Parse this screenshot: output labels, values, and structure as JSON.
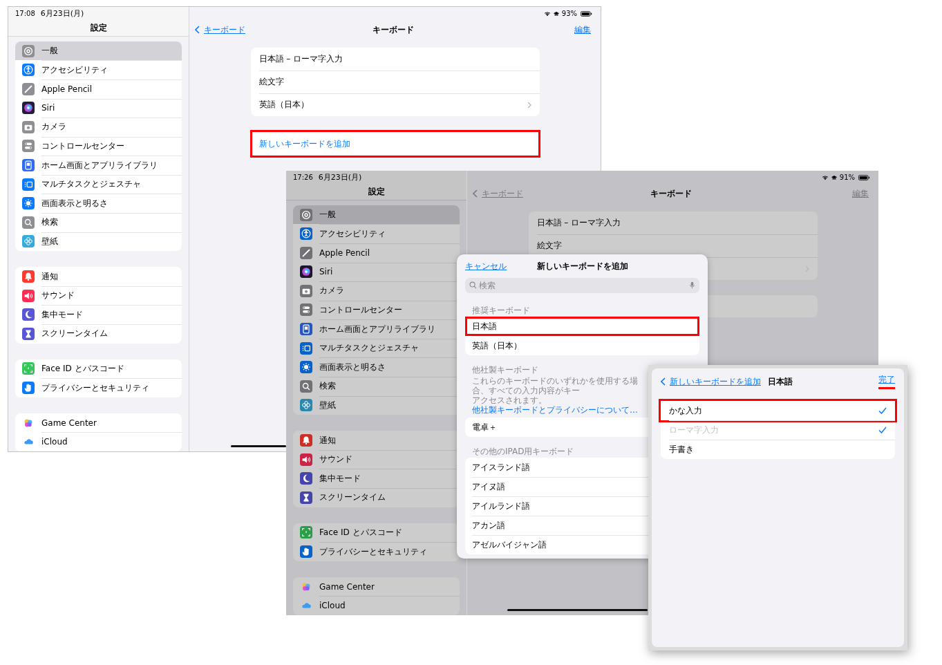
{
  "screenshots": [
    {
      "status_bar": {
        "time": "17:08",
        "date": "6月23日(月)",
        "battery": "93%"
      },
      "sidebar": {
        "title": "設定",
        "groups": [
          [
            {
              "label": "一般",
              "color": "#8e8e93",
              "selected": true
            },
            {
              "label": "アクセシビリティ",
              "color": "#0a7aff",
              "selected": false
            },
            {
              "label": "Apple Pencil",
              "color": "#8e8e93",
              "selected": false
            },
            {
              "label": "Siri",
              "color": "#1f1d3a",
              "selected": false
            },
            {
              "label": "カメラ",
              "color": "#8e8e93",
              "selected": false
            },
            {
              "label": "コントロールセンター",
              "color": "#8e8e93",
              "selected": false
            },
            {
              "label": "ホーム画面とアプリライブラリ",
              "color": "#2f6cf0",
              "selected": false
            },
            {
              "label": "マルチタスクとジェスチャ",
              "color": "#0a7aff",
              "selected": false
            },
            {
              "label": "画面表示と明るさ",
              "color": "#0a7aff",
              "selected": false
            },
            {
              "label": "検索",
              "color": "#8e8e93",
              "selected": false
            },
            {
              "label": "壁紙",
              "color": "#35aadc",
              "selected": false
            }
          ],
          [
            {
              "label": "通知",
              "color": "#ff3b30",
              "selected": false
            },
            {
              "label": "サウンド",
              "color": "#ff2d55",
              "selected": false
            },
            {
              "label": "集中モード",
              "color": "#5856d6",
              "selected": false
            },
            {
              "label": "スクリーンタイム",
              "color": "#5856d6",
              "selected": false
            }
          ],
          [
            {
              "label": "Face ID とパスコード",
              "color": "#34c759",
              "selected": false
            },
            {
              "label": "プライバシーとセキュリティ",
              "color": "#0a7aff",
              "selected": false
            }
          ],
          [
            {
              "label": "Game Center",
              "color": "#ffffff",
              "selected": false
            },
            {
              "label": "iCloud",
              "color": "#ffffff",
              "selected": false
            }
          ]
        ]
      },
      "detail": {
        "back": "キーボード",
        "title": "キーボード",
        "edit": "編集",
        "rows": [
          {
            "label": "日本語 – ローマ字入力",
            "chevron": false
          },
          {
            "label": "絵文字",
            "chevron": false
          },
          {
            "label": "英語（日本）",
            "chevron": true
          }
        ],
        "add_button": {
          "label": "新しいキーボードを追加",
          "highlighted": true
        }
      }
    },
    {
      "status_bar": {
        "time": "17:26",
        "date": "6月23日(月)",
        "battery": "91%"
      },
      "sidebar": {
        "title": "設定",
        "groups": [
          [
            {
              "label": "一般",
              "color": "#727276",
              "selected": true
            },
            {
              "label": "アクセシビリティ",
              "color": "#0862cc",
              "selected": false
            },
            {
              "label": "Apple Pencil",
              "color": "#727276",
              "selected": false
            },
            {
              "label": "Siri",
              "color": "#19172e",
              "selected": false
            },
            {
              "label": "カメラ",
              "color": "#727276",
              "selected": false
            },
            {
              "label": "コントロールセンター",
              "color": "#727276",
              "selected": false
            },
            {
              "label": "ホーム画面とアプリライブラリ",
              "color": "#2656c0",
              "selected": false
            },
            {
              "label": "マルチタスクとジェスチャ",
              "color": "#0862cc",
              "selected": false
            },
            {
              "label": "画面表示と明るさ",
              "color": "#0862cc",
              "selected": false
            },
            {
              "label": "検索",
              "color": "#727276",
              "selected": false
            },
            {
              "label": "壁紙",
              "color": "#2a88b0",
              "selected": false
            }
          ],
          [
            {
              "label": "通知",
              "color": "#cc2f26",
              "selected": false
            },
            {
              "label": "サウンド",
              "color": "#cc2444",
              "selected": false
            },
            {
              "label": "集中モード",
              "color": "#4645ab",
              "selected": false
            },
            {
              "label": "スクリーンタイム",
              "color": "#4645ab",
              "selected": false
            }
          ],
          [
            {
              "label": "Face ID とパスコード",
              "color": "#2a9f47",
              "selected": false
            },
            {
              "label": "プライバシーとセキュリティ",
              "color": "#0862cc",
              "selected": false
            }
          ],
          [
            {
              "label": "Game Center",
              "color": "#cccccc",
              "selected": false
            },
            {
              "label": "iCloud",
              "color": "#cccccc",
              "selected": false
            }
          ]
        ]
      },
      "detail": {
        "back": "キーボード",
        "title": "キーボード",
        "edit": "編集",
        "rows": [
          {
            "label": "日本語 – ローマ字入力",
            "chevron": false
          },
          {
            "label": "絵文字",
            "chevron": false
          },
          {
            "chevron": true
          }
        ]
      },
      "modal": {
        "cancel": "キャンセル",
        "title": "新しいキーボードを追加",
        "search_placeholder": "検索",
        "sections": [
          {
            "header": "推奨キーボード",
            "rows": [
              {
                "label": "日本語",
                "highlighted": true
              },
              {
                "label": "英語（日本）",
                "highlighted": false
              }
            ]
          },
          {
            "header": "他社製キーボード",
            "note": "これらのキーボードのいずれかを使用する場合、すべての入力内容がキー",
            "note_2": "アクセスされます。",
            "note_link": "他社製キーボードとプライバシーについて…",
            "rows": [
              {
                "label": "電卓＋",
                "highlighted": false
              }
            ]
          },
          {
            "header": "その他のIPAD用キーボード",
            "rows": [
              {
                "label": "アイスランド語",
                "highlighted": false
              },
              {
                "label": "アイヌ語",
                "highlighted": false
              },
              {
                "label": "アイルランド語",
                "highlighted": false
              },
              {
                "label": "アカン語",
                "highlighted": false
              },
              {
                "label": "アゼルバイジャン語",
                "highlighted": false
              }
            ]
          }
        ]
      }
    }
  ],
  "japanese_sheet": {
    "back": "新しいキーボードを追加",
    "title": "日本語",
    "done": {
      "label": "完了",
      "highlighted": true
    },
    "options": [
      {
        "label": "かな入力",
        "checked": true,
        "disabled": false,
        "highlighted": true
      },
      {
        "label": "ローマ字入力",
        "checked": true,
        "disabled": true,
        "highlighted": false
      },
      {
        "label": "手書き",
        "checked": false,
        "disabled": false,
        "highlighted": false
      }
    ]
  }
}
